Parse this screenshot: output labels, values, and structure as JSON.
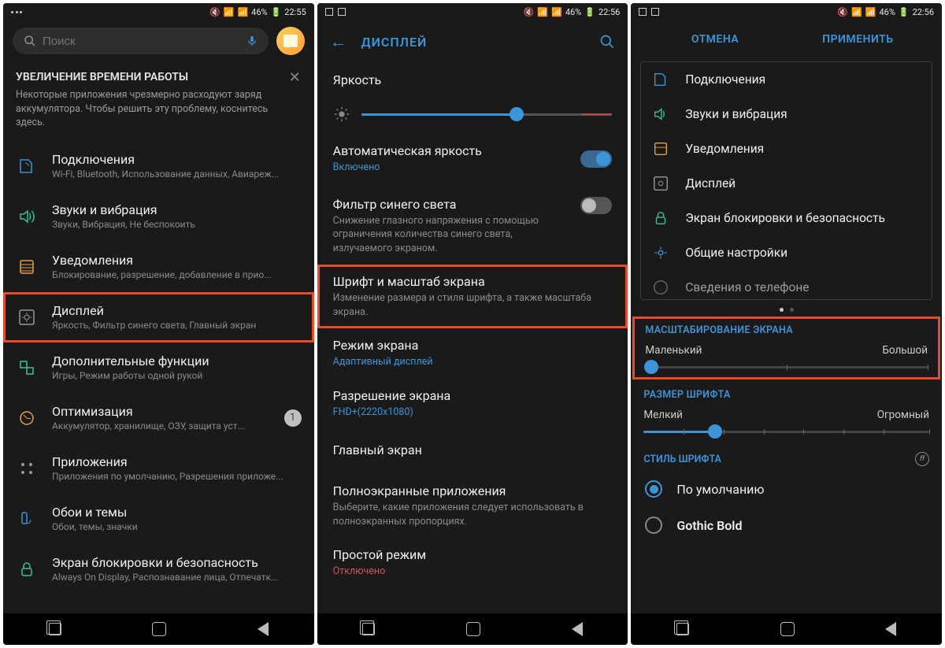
{
  "screen1": {
    "status": {
      "battery": "46%",
      "time": "22:55"
    },
    "search_placeholder": "Поиск",
    "tip": {
      "title": "УВЕЛИЧЕНИЕ ВРЕМЕНИ РАБОТЫ",
      "body": "Некоторые приложения чрезмерно расходуют заряд аккумулятора. Чтобы решить эту проблему, коснитесь здесь."
    },
    "items": [
      {
        "title": "Подключения",
        "sub": "Wi-Fi, Bluetooth, Использование данных, Авиареж..."
      },
      {
        "title": "Звуки и вибрация",
        "sub": "Звуки, Вибрация, Не беспокоить"
      },
      {
        "title": "Уведомления",
        "sub": "Блокирование, разрешение, добавление в прио..."
      },
      {
        "title": "Дисплей",
        "sub": "Яркость, Фильтр синего света, Главный экран"
      },
      {
        "title": "Дополнительные функции",
        "sub": "Игры, Режим работы одной рукой"
      },
      {
        "title": "Оптимизация",
        "sub": "Аккумулятор, хранилище, ОЗУ, защита уст...",
        "badge": "1"
      },
      {
        "title": "Приложения",
        "sub": "Приложения по умолчанию, Разрешения приложе..."
      },
      {
        "title": "Обои и темы",
        "sub": "Обои, темы, значки"
      },
      {
        "title": "Экран блокировки и безопасность",
        "sub": "Always On Display, Распознавание лица, Отпечатк..."
      }
    ]
  },
  "screen2": {
    "status": {
      "battery": "46%",
      "time": "22:56"
    },
    "header": "ДИСПЛЕЙ",
    "brightness_label": "Яркость",
    "brightness_pct": 62,
    "auto_brightness": {
      "title": "Автоматическая яркость",
      "state": "Включено",
      "on": true
    },
    "blue_filter": {
      "title": "Фильтр синего света",
      "sub": "Снижение глазного напряжения с помощью ограничения количества синего света, излучаемого экраном.",
      "on": false
    },
    "font_zoom": {
      "title": "Шрифт и масштаб экрана",
      "sub": "Изменение размера и стиля шрифта, а также масштаба экрана."
    },
    "screen_mode": {
      "title": "Режим экрана",
      "sub": "Адаптивный дисплей"
    },
    "resolution": {
      "title": "Разрешение экрана",
      "sub": "FHD+(2220x1080)"
    },
    "home": {
      "title": "Главный экран"
    },
    "fullscreen": {
      "title": "Полноэкранные приложения",
      "sub": "Выберите, какие приложения следует использовать в полноэкранных пропорциях."
    },
    "simple": {
      "title": "Простой режим",
      "sub": "Отключено"
    }
  },
  "screen3": {
    "status": {
      "battery": "46%",
      "time": "22:56"
    },
    "cancel": "ОТМЕНА",
    "apply": "ПРИМЕНИТЬ",
    "grid": [
      "Подключения",
      "Звуки и вибрация",
      "Уведомления",
      "Дисплей",
      "Экран блокировки и безопасность",
      "Общие настройки",
      "Сведения о телефоне"
    ],
    "zoom_header": "МАСШТАБИРОВАНИЕ ЭКРАНА",
    "zoom_min": "Маленький",
    "zoom_max": "Большой",
    "zoom_pct": 2,
    "font_header": "РАЗМЕР ШРИФТА",
    "font_min": "Мелкий",
    "font_max": "Огромный",
    "font_pct": 25,
    "style_header": "СТИЛЬ ШРИФТА",
    "styles": [
      {
        "label": "По умолчанию",
        "checked": true
      },
      {
        "label": "Gothic Bold",
        "checked": false
      }
    ]
  }
}
